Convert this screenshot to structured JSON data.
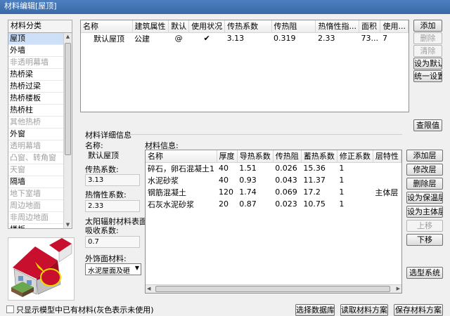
{
  "window": {
    "title": "材料编辑[屋顶]"
  },
  "category": {
    "header": "材料分类",
    "items": [
      {
        "label": "屋顶",
        "gray": false,
        "selected": true
      },
      {
        "label": "外墙",
        "gray": false
      },
      {
        "label": "非透明幕墙",
        "gray": true
      },
      {
        "label": "热桥梁",
        "gray": false
      },
      {
        "label": "热桥过梁",
        "gray": false
      },
      {
        "label": "热桥楼板",
        "gray": false
      },
      {
        "label": "热桥柱",
        "gray": false
      },
      {
        "label": "其他热桥",
        "gray": true
      },
      {
        "label": "外窗",
        "gray": false
      },
      {
        "label": "透明幕墙",
        "gray": true
      },
      {
        "label": "凸窗、转角窗",
        "gray": true
      },
      {
        "label": "天窗",
        "gray": true
      },
      {
        "label": "隔墙",
        "gray": false
      },
      {
        "label": "地下室墙",
        "gray": true
      },
      {
        "label": "周边地面",
        "gray": true
      },
      {
        "label": "非周边地面",
        "gray": true
      },
      {
        "label": "楼板",
        "gray": false
      }
    ]
  },
  "materials_table": {
    "headers": [
      "名称",
      "建筑属性",
      "默认",
      "使用状况",
      "传热系数",
      "传热阻",
      "热惰性指...",
      "面积",
      "使用..."
    ],
    "rows": [
      [
        "默认屋顶",
        "公建",
        "@",
        "✔",
        "3.13",
        "0.319",
        "2.33",
        "73...",
        "7"
      ]
    ]
  },
  "right_buttons": {
    "add": "添加",
    "delete": "删除",
    "clear": "清除",
    "set_default": "设为默认",
    "unify": "统一设置",
    "lookup": "查限值"
  },
  "detail": {
    "group_title": "材料详细信息",
    "name_label": "名称:",
    "name_value": "默认屋顶",
    "u_label": "传热系数:",
    "u_value": "3.13",
    "d_label": "热惰性系数:",
    "d_value": "2.33",
    "solar_label_1": "太阳辐射材料表面",
    "solar_label_2": "吸收系数:",
    "solar_value": "0.7",
    "finish_label": "外饰面材料:",
    "finish_value": "水泥屋面及砸"
  },
  "layers": {
    "title": "材料信息:",
    "headers": [
      "名称",
      "厚度",
      "导热系数",
      "传热阻",
      "蓄热系数",
      "修正系数",
      "层特性"
    ],
    "rows": [
      [
        "碎石，卵石混凝土1",
        "40",
        "1.51",
        "0.026",
        "15.36",
        "1",
        ""
      ],
      [
        "水泥砂浆",
        "40",
        "0.93",
        "0.043",
        "11.37",
        "1",
        ""
      ],
      [
        "钢筋混凝土",
        "120",
        "1.74",
        "0.069",
        "17.2",
        "1",
        "主体层"
      ],
      [
        "石灰水泥砂浆",
        "20",
        "0.87",
        "0.023",
        "10.75",
        "1",
        ""
      ]
    ]
  },
  "layer_buttons": {
    "add": "添加层",
    "modify": "修改层",
    "delete": "删除层",
    "set_insul": "设为保温层",
    "set_main": "设为主体层",
    "up": "上移",
    "down": "下移",
    "select_system": "选型系统"
  },
  "bottom": {
    "checkbox_label": "只显示模型中已有材料(灰色表示未使用)",
    "select_db": "选择数据库",
    "read_scheme": "读取材料方案",
    "save_scheme": "保存材料方案"
  },
  "colors": {
    "title_bar": "#3a6aa6",
    "selection": "#cde0f7",
    "roof_red": "#c8102e"
  }
}
